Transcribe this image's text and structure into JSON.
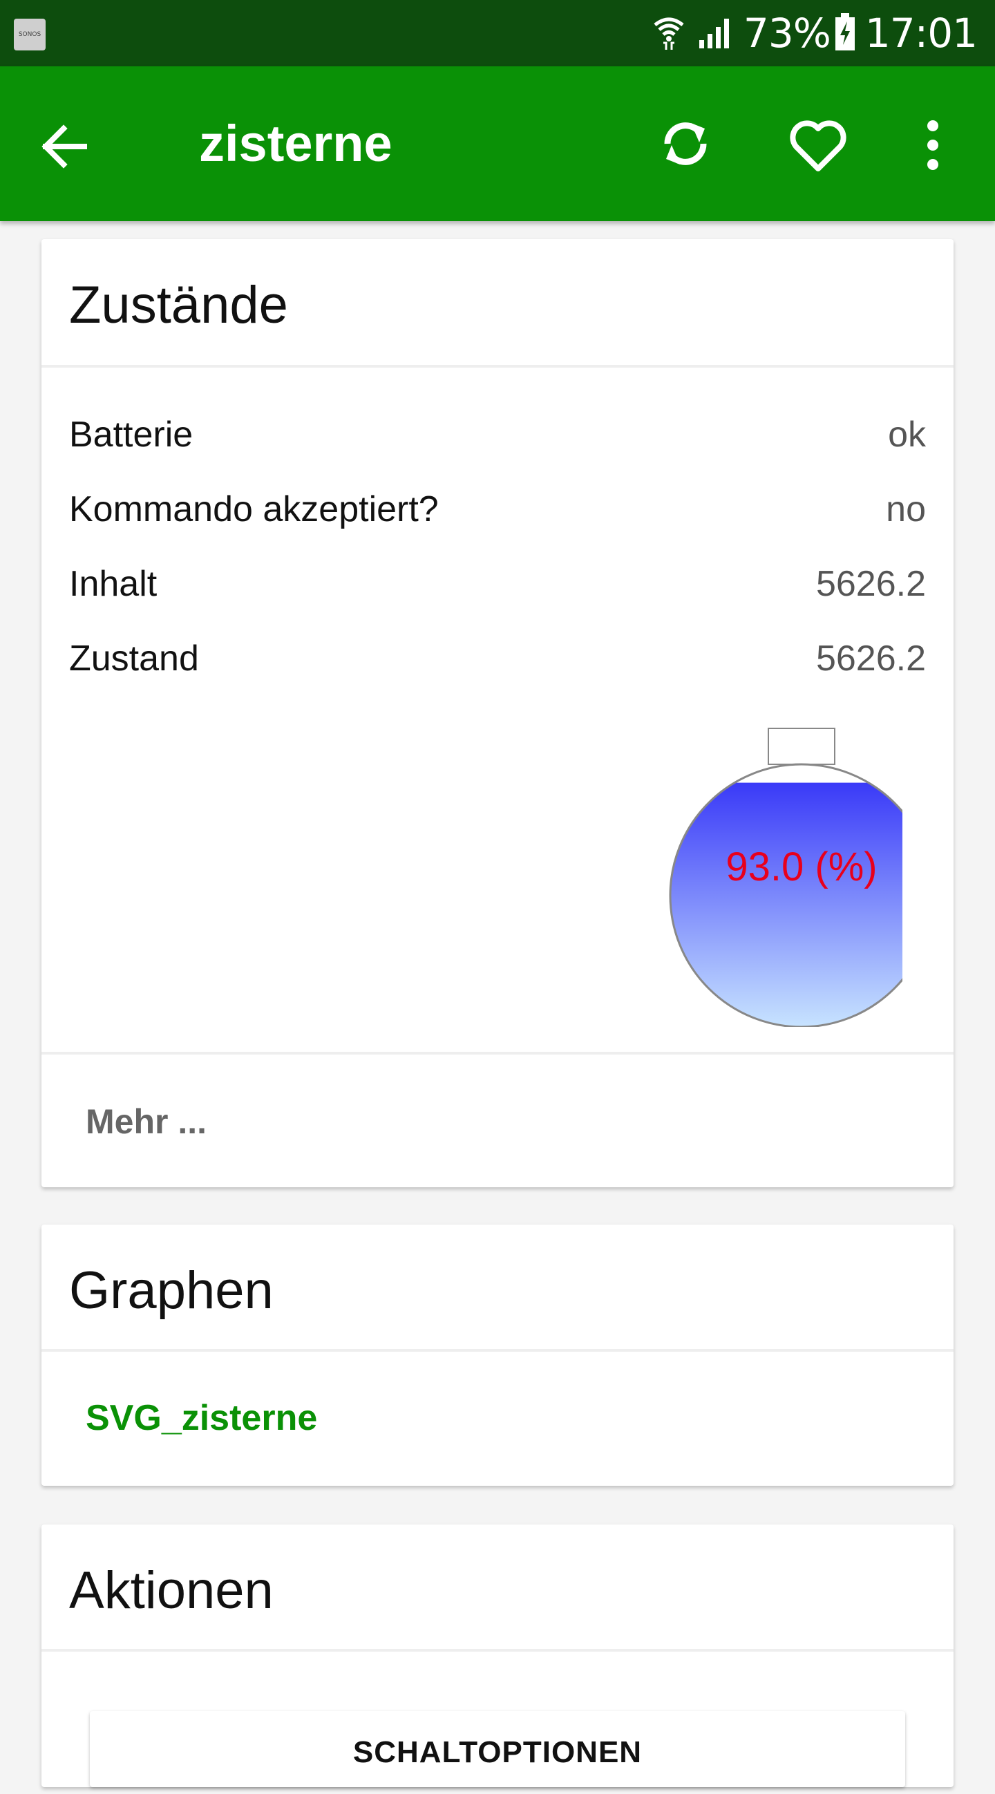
{
  "status_bar": {
    "app_icon_label": "SONOS",
    "battery_percent": "73%",
    "time": "17:01"
  },
  "app_bar": {
    "title": "zisterne",
    "icons": [
      "back-arrow-icon",
      "refresh-icon",
      "heart-icon",
      "more-vert-icon"
    ]
  },
  "zustaende": {
    "title": "Zustände",
    "rows": [
      {
        "label": "Batterie",
        "value": "ok"
      },
      {
        "label": "Kommando akzeptiert?",
        "value": "no"
      },
      {
        "label": "Inhalt",
        "value": "5626.2"
      },
      {
        "label": "Zustand",
        "value": "5626.2"
      }
    ],
    "gauge": {
      "fill_fraction": 0.93,
      "label": "93.0 (%)",
      "colors": {
        "top": "#3a3af8",
        "bottom": "#c8e4ff",
        "label": "#e8001c",
        "outline": "#888888"
      }
    },
    "more_link": "Mehr ..."
  },
  "graphen": {
    "title": "Graphen",
    "link": "SVG_zisterne"
  },
  "aktionen": {
    "title": "Aktionen",
    "button": "SCHALTOPTIONEN"
  },
  "colors": {
    "status_bar": "#0d4d0d",
    "app_bar": "#0a9106",
    "link_green": "#0a9106"
  }
}
